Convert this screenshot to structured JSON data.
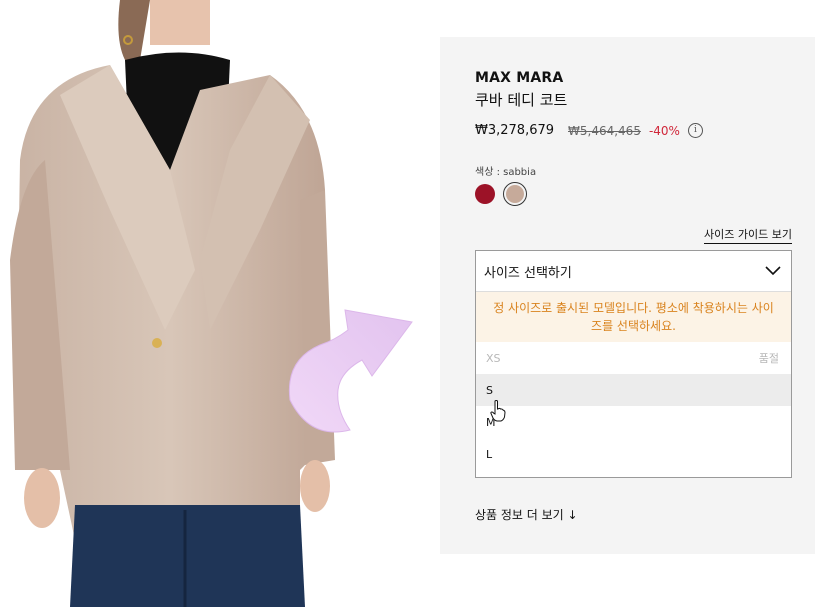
{
  "product": {
    "brand": "MAX MARA",
    "name": "쿠바 테디 코트",
    "price": "₩3,278,679",
    "original_price": "₩5,464,465",
    "discount": "-40%",
    "info_icon": "info-icon"
  },
  "color": {
    "label": "색상 : sabbia",
    "swatches": [
      "#9c1227",
      "#c6aa9a"
    ]
  },
  "size_guide": "사이즈 가이드 보기",
  "size_select": {
    "placeholder": "사이즈 선택하기",
    "notice": "정 사이즈로 출시된 모델입니다. 평소에 착용하시는 사이즈를 선택하세요.",
    "options": [
      {
        "label": "XS",
        "status": "품절"
      },
      {
        "label": "S",
        "status": ""
      },
      {
        "label": "M",
        "status": ""
      },
      {
        "label": "L",
        "status": ""
      }
    ]
  },
  "more_info": "상품 정보 더 보기 ↓"
}
